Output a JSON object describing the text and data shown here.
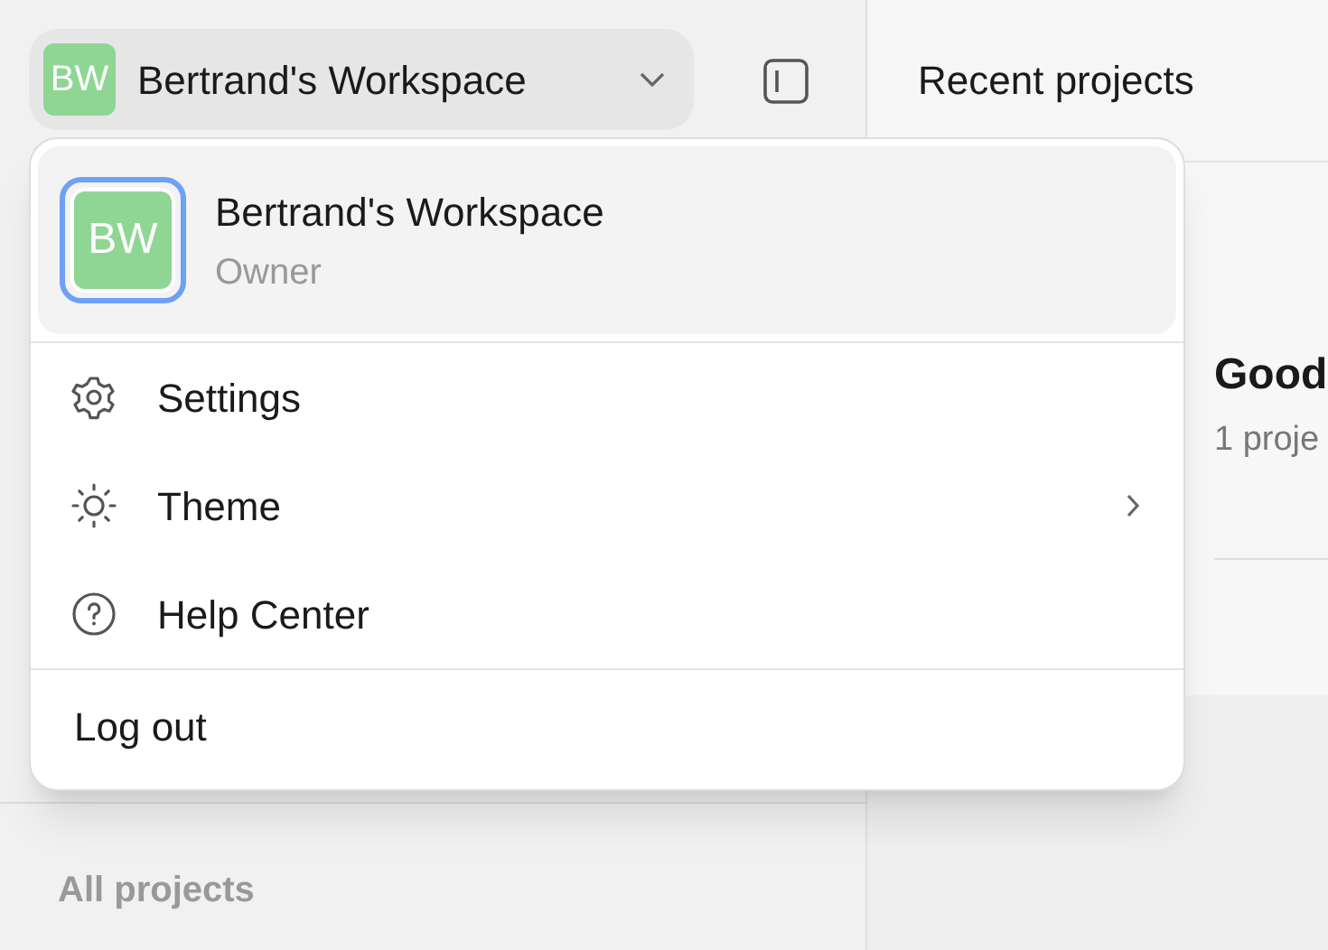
{
  "workspace_button": {
    "avatar": "BW",
    "name": "Bertrand's Workspace"
  },
  "recent_projects": {
    "title": "Recent projects",
    "card": {
      "title": "Good",
      "subtitle": "1 proje"
    }
  },
  "sidebar": {
    "section": "All projects"
  },
  "menu": {
    "workspaces": [
      {
        "avatar": "BW",
        "name": "Bertrand's Workspace",
        "role": "Owner",
        "selected": true
      }
    ],
    "items": [
      {
        "label": "Settings",
        "has_submenu": false
      },
      {
        "label": "Theme",
        "has_submenu": true
      },
      {
        "label": "Help Center",
        "has_submenu": false
      }
    ],
    "footer": "Log out"
  }
}
